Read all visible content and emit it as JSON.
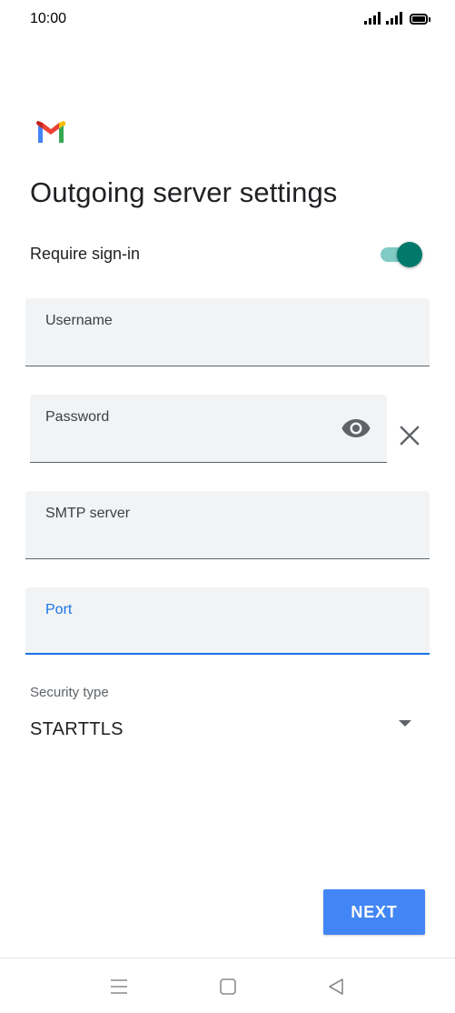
{
  "status_bar": {
    "time": "10:00"
  },
  "header": {
    "logo_icon": "gmail-logo-icon",
    "title": "Outgoing server settings"
  },
  "require_signin": {
    "label": "Require sign-in",
    "enabled": true
  },
  "fields": {
    "username": {
      "label": "Username",
      "value": ""
    },
    "password": {
      "label": "Password",
      "value": ""
    },
    "smtp_server": {
      "label": "SMTP server",
      "value": ""
    },
    "port": {
      "label": "Port",
      "value": "",
      "focused": true
    }
  },
  "security": {
    "label": "Security type",
    "selected": "STARTTLS"
  },
  "actions": {
    "next_label": "NEXT"
  },
  "colors": {
    "accent_blue": "#4285f4",
    "focus_blue": "#1a73e8",
    "toggle_teal": "#00796b",
    "field_bg": "#f1f3f4"
  }
}
